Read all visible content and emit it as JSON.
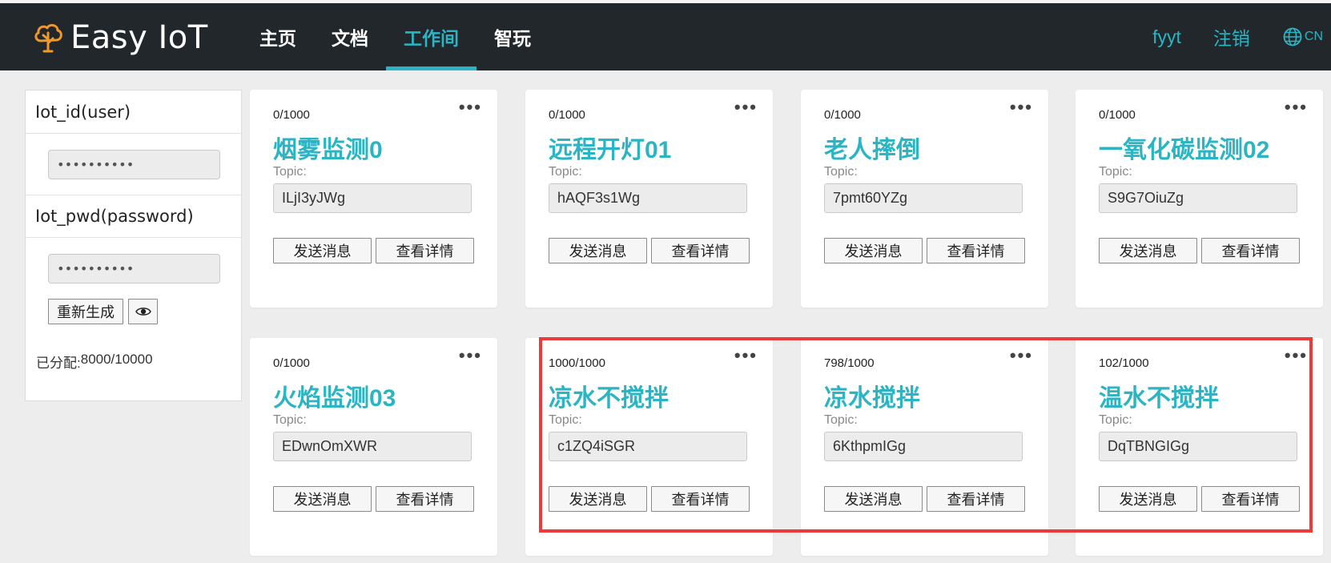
{
  "header": {
    "logo_text": "Easy IoT",
    "nav": [
      {
        "label": "主页"
      },
      {
        "label": "文档"
      },
      {
        "label": "工作间"
      },
      {
        "label": "智玩"
      }
    ],
    "active_nav": "工作间",
    "user": "fyyt",
    "logout": "注销",
    "lang": "CN"
  },
  "sidebar": {
    "id_label": "Iot_id(user)",
    "id_value": "••••••••••",
    "pwd_label": "Iot_pwd(password)",
    "pwd_value": "••••••••••",
    "regenerate": "重新生成",
    "allocated_label": "已分配:",
    "allocated_value": "8000/10000"
  },
  "card_labels": {
    "topic": "Topic:",
    "send": "发送消息",
    "details": "查看详情",
    "more": "•••"
  },
  "cards": [
    {
      "count": "0/1000",
      "title": "烟雾监测0",
      "topic": "ILjI3yJWg"
    },
    {
      "count": "0/1000",
      "title": "远程开灯01",
      "topic": "hAQF3s1Wg"
    },
    {
      "count": "0/1000",
      "title": "老人摔倒",
      "topic": "7pmt60YZg"
    },
    {
      "count": "0/1000",
      "title": "一氧化碳监测02",
      "topic": "S9G7OiuZg"
    },
    {
      "count": "0/1000",
      "title": "火焰监测03",
      "topic": "EDwnOmXWR"
    },
    {
      "count": "1000/1000",
      "title": "凉水不搅拌",
      "topic": "c1ZQ4iSGR"
    },
    {
      "count": "798/1000",
      "title": "凉水搅拌",
      "topic": "6KthpmIGg"
    },
    {
      "count": "102/1000",
      "title": "温水不搅拌",
      "topic": "DqTBNGIGg"
    }
  ],
  "colors": {
    "accent": "#2bb5c4",
    "header_bg": "#22272b",
    "highlight": "#ec3a3a"
  }
}
